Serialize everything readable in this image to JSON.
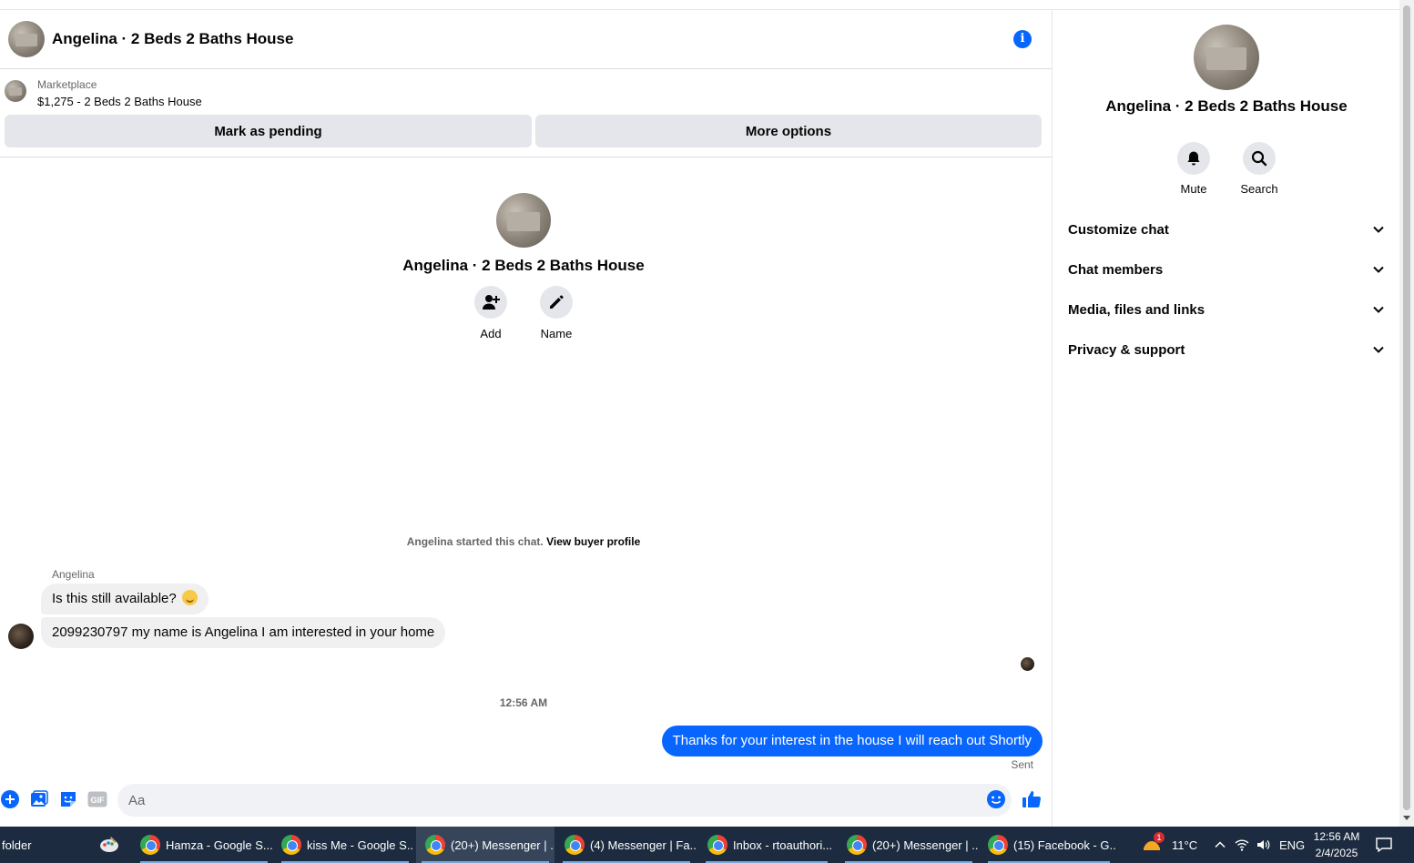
{
  "chat": {
    "title": "Angelina · 2 Beds 2 Baths House",
    "marketplace": {
      "label": "Marketplace",
      "listing": "$1,275 - 2 Beds 2 Baths House",
      "pending_button": "Mark as pending",
      "more_button": "More options"
    },
    "intro": {
      "title": "Angelina · 2 Beds 2 Baths House",
      "add_label": "Add",
      "name_label": "Name"
    },
    "started_text": "Angelina started this chat.",
    "buyer_profile_link": "View buyer profile",
    "sender_name": "Angelina",
    "messages_in": [
      "Is this still available?",
      "2099230797 my name is Angelina I am interested in your home"
    ],
    "timestamp": "12:56 AM",
    "message_out": "Thanks for your interest in the house I will reach out Shortly",
    "sent_label": "Sent",
    "composer_placeholder": "Aa"
  },
  "panel": {
    "title": "Angelina · 2 Beds 2 Baths House",
    "mute_label": "Mute",
    "search_label": "Search",
    "sections": [
      "Customize chat",
      "Chat members",
      "Media, files and links",
      "Privacy & support"
    ]
  },
  "taskbar": {
    "items": [
      "folder",
      "Hamza - Google S...",
      "kiss Me - Google S...",
      "(20+) Messenger | ...",
      "(4) Messenger | Fa...",
      "Inbox - rtoauthori...",
      "(20+) Messenger | ...",
      "(15) Facebook - G..."
    ],
    "weather_badge": "1",
    "temperature": "11°C",
    "language": "ENG",
    "time": "12:56 AM",
    "date": "2/4/2025"
  },
  "colors": {
    "accent": "#0866ff",
    "bubble_in": "#f0f0f0",
    "button_gray": "#e4e6eb",
    "taskbar": "#1c2b3f"
  }
}
